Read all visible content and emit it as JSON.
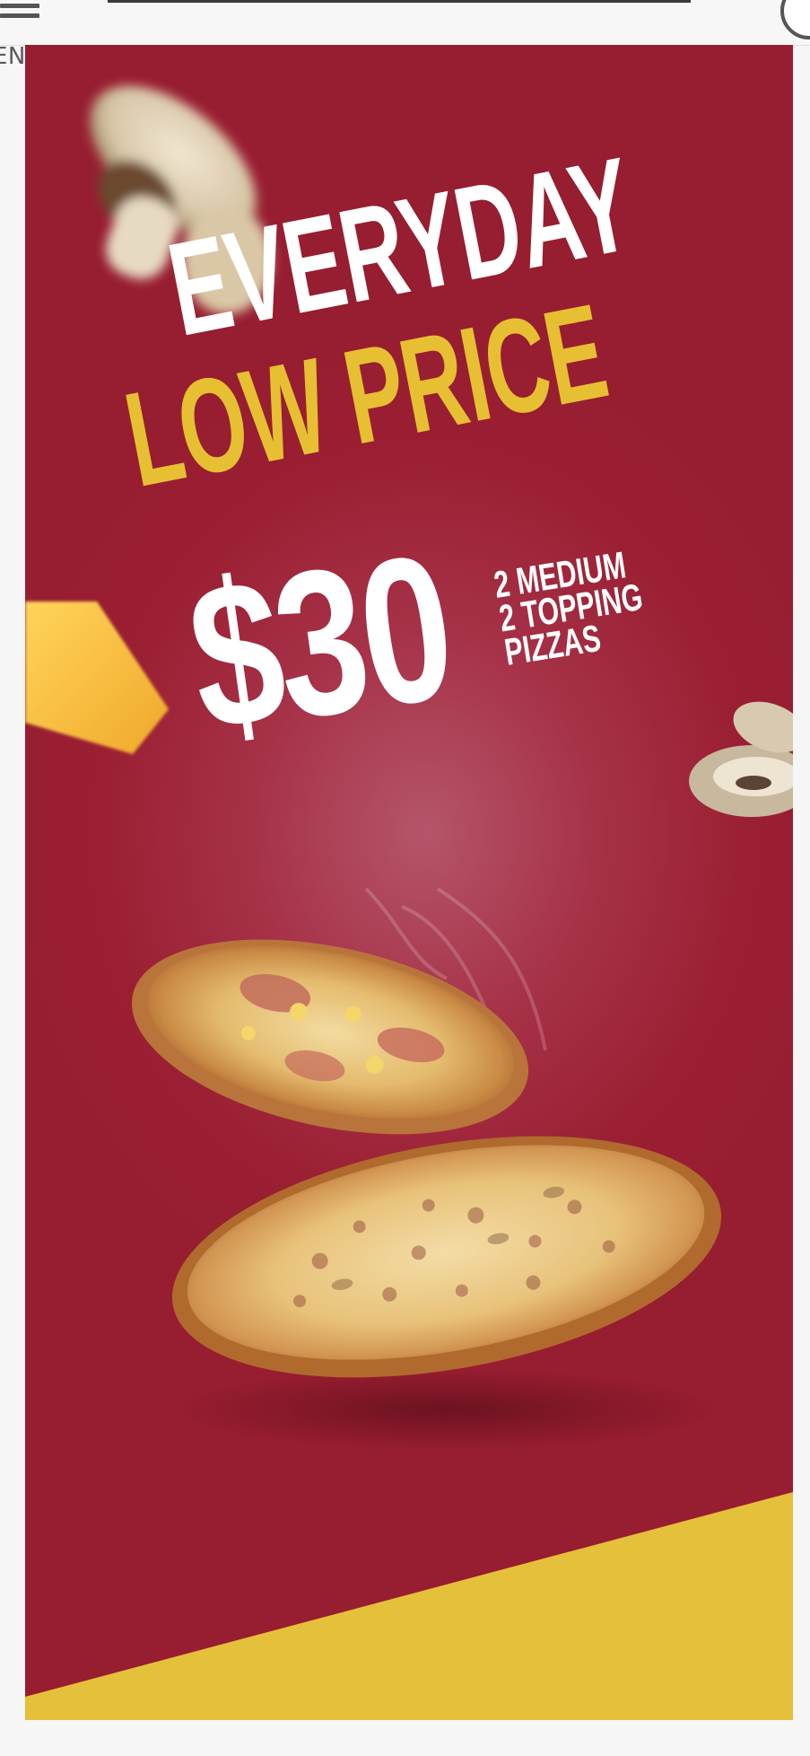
{
  "header": {
    "menu_label": "ENU"
  },
  "promo": {
    "headline_line1": "EVERYDAY",
    "headline_line2": "LOW PRICE",
    "price": "$30",
    "offer_line1": "2 MEDIUM",
    "offer_line2": "2 TOPPING",
    "offer_line3": "PIZZAS"
  },
  "colors": {
    "banner_red": "#9b1f33",
    "accent_yellow": "#e7bf32",
    "text_white": "#ffffff"
  },
  "icons": {
    "menu": "hamburger-icon"
  }
}
